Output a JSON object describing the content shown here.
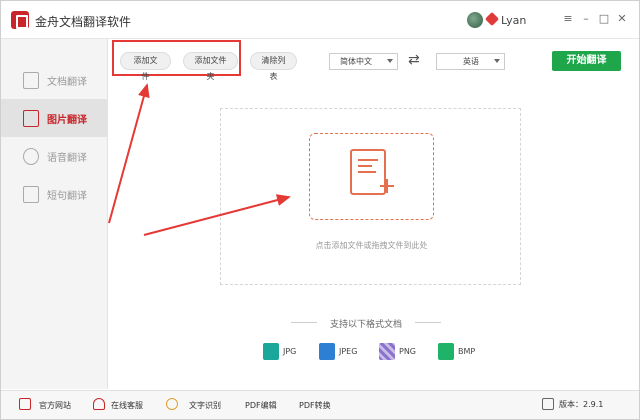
{
  "window": {
    "title": "金舟文档翻译软件",
    "user": "Lyan",
    "controls": [
      "≡",
      "–",
      "□",
      "✕"
    ]
  },
  "sidebar": {
    "items": [
      {
        "label": "文档翻译",
        "active": false
      },
      {
        "label": "图片翻译",
        "active": true
      },
      {
        "label": "语音翻译",
        "active": false
      },
      {
        "label": "短句翻译",
        "active": false
      }
    ]
  },
  "toolbar": {
    "add_file": "添加文件",
    "add_folder": "添加文件夹",
    "clear_list": "清除列表",
    "source_lang": "简体中文",
    "target_lang": "英语",
    "start": "开始翻译"
  },
  "dropzone": {
    "hint": "点击添加文件或拖拽文件到此处"
  },
  "formats": {
    "title": "支持以下格式文档",
    "items": [
      {
        "label": "JPG",
        "icon": "jpg-icon",
        "color": "#19a79c"
      },
      {
        "label": "JPEG",
        "icon": "jpeg-icon",
        "color": "#2d7fd3"
      },
      {
        "label": "PNG",
        "icon": "png-icon",
        "color": "#8a74c9"
      },
      {
        "label": "BMP",
        "icon": "bmp-icon",
        "color": "#1fb36a"
      }
    ]
  },
  "footer": {
    "website": "官方网站",
    "support": "在线客服",
    "ocr": "文字识别",
    "pdf_edit": "PDF编辑",
    "pdf_convert": "PDF转换",
    "version_label": "版本：2.9.1"
  },
  "colors": {
    "accent": "#c8262a",
    "start_button": "#1fa54a",
    "annotation": "#e53935"
  }
}
